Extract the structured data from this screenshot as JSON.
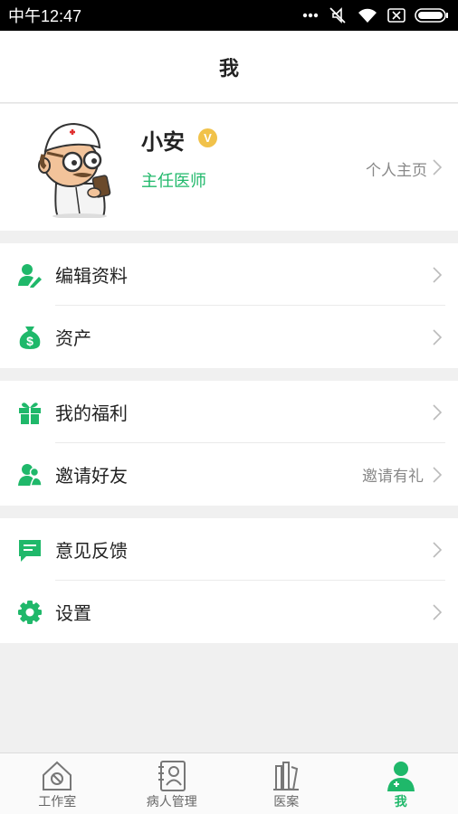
{
  "status_bar": {
    "time": "中午12:47"
  },
  "header": {
    "title": "我"
  },
  "profile": {
    "name": "小安",
    "badge": "V",
    "title": "主任医师",
    "homepage_label": "个人主页"
  },
  "menu_groups": [
    {
      "items": [
        {
          "label": "编辑资料",
          "icon": "edit-profile-icon"
        },
        {
          "label": "资产",
          "icon": "money-bag-icon"
        }
      ]
    },
    {
      "items": [
        {
          "label": "我的福利",
          "icon": "gift-icon"
        },
        {
          "label": "邀请好友",
          "icon": "invite-friend-icon",
          "extra": "邀请有礼"
        }
      ]
    },
    {
      "items": [
        {
          "label": "意见反馈",
          "icon": "feedback-icon"
        },
        {
          "label": "设置",
          "icon": "gear-icon"
        }
      ]
    }
  ],
  "tabbar": {
    "tabs": [
      {
        "label": "工作室",
        "icon": "home-icon"
      },
      {
        "label": "病人管理",
        "icon": "patient-book-icon"
      },
      {
        "label": "医案",
        "icon": "books-icon"
      },
      {
        "label": "我",
        "icon": "doctor-profile-icon",
        "active": true
      }
    ]
  },
  "colors": {
    "accent": "#1fb86a",
    "badge": "#f1c24a",
    "background": "#f0f0f0"
  }
}
